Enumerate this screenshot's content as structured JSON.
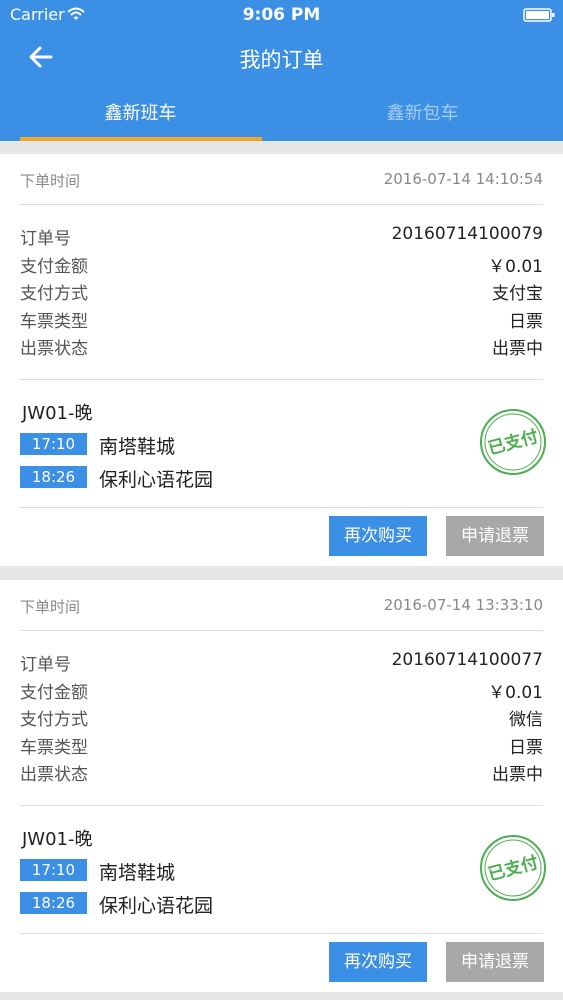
{
  "status_bar": {
    "carrier": "Carrier",
    "time": "9:06 PM"
  },
  "nav": {
    "title": "我的订单"
  },
  "tabs": [
    {
      "label": "鑫新班车",
      "active": true
    },
    {
      "label": "鑫新包车",
      "active": false
    }
  ],
  "colors": {
    "primary": "#3b8fe5",
    "tab_indicator": "#f0a52c",
    "stamp": "#4caf50",
    "disabled_button": "#a8a8a8"
  },
  "orders": [
    {
      "order_time_label": "下单时间",
      "order_time": "2016-07-14 14:10:54",
      "details": [
        {
          "label": "订单号",
          "value": "20160714100079"
        },
        {
          "label": "支付金额",
          "value": "￥0.01"
        },
        {
          "label": "支付方式",
          "value": "支付宝"
        },
        {
          "label": "车票类型",
          "value": "日票"
        },
        {
          "label": "出票状态",
          "value": "出票中"
        }
      ],
      "route": "JW01-晚",
      "stops": [
        {
          "time": "17:10",
          "name": "南塔鞋城"
        },
        {
          "time": "18:26",
          "name": "保利心语花园"
        }
      ],
      "stamp": "已支付",
      "buttons": {
        "rebuy": "再次购买",
        "refund": "申请退票"
      }
    },
    {
      "order_time_label": "下单时间",
      "order_time": "2016-07-14 13:33:10",
      "details": [
        {
          "label": "订单号",
          "value": "20160714100077"
        },
        {
          "label": "支付金额",
          "value": "￥0.01"
        },
        {
          "label": "支付方式",
          "value": "微信"
        },
        {
          "label": "车票类型",
          "value": "日票"
        },
        {
          "label": "出票状态",
          "value": "出票中"
        }
      ],
      "route": "JW01-晚",
      "stops": [
        {
          "time": "17:10",
          "name": "南塔鞋城"
        },
        {
          "time": "18:26",
          "name": "保利心语花园"
        }
      ],
      "stamp": "已支付",
      "buttons": {
        "rebuy": "再次购买",
        "refund": "申请退票"
      }
    }
  ]
}
